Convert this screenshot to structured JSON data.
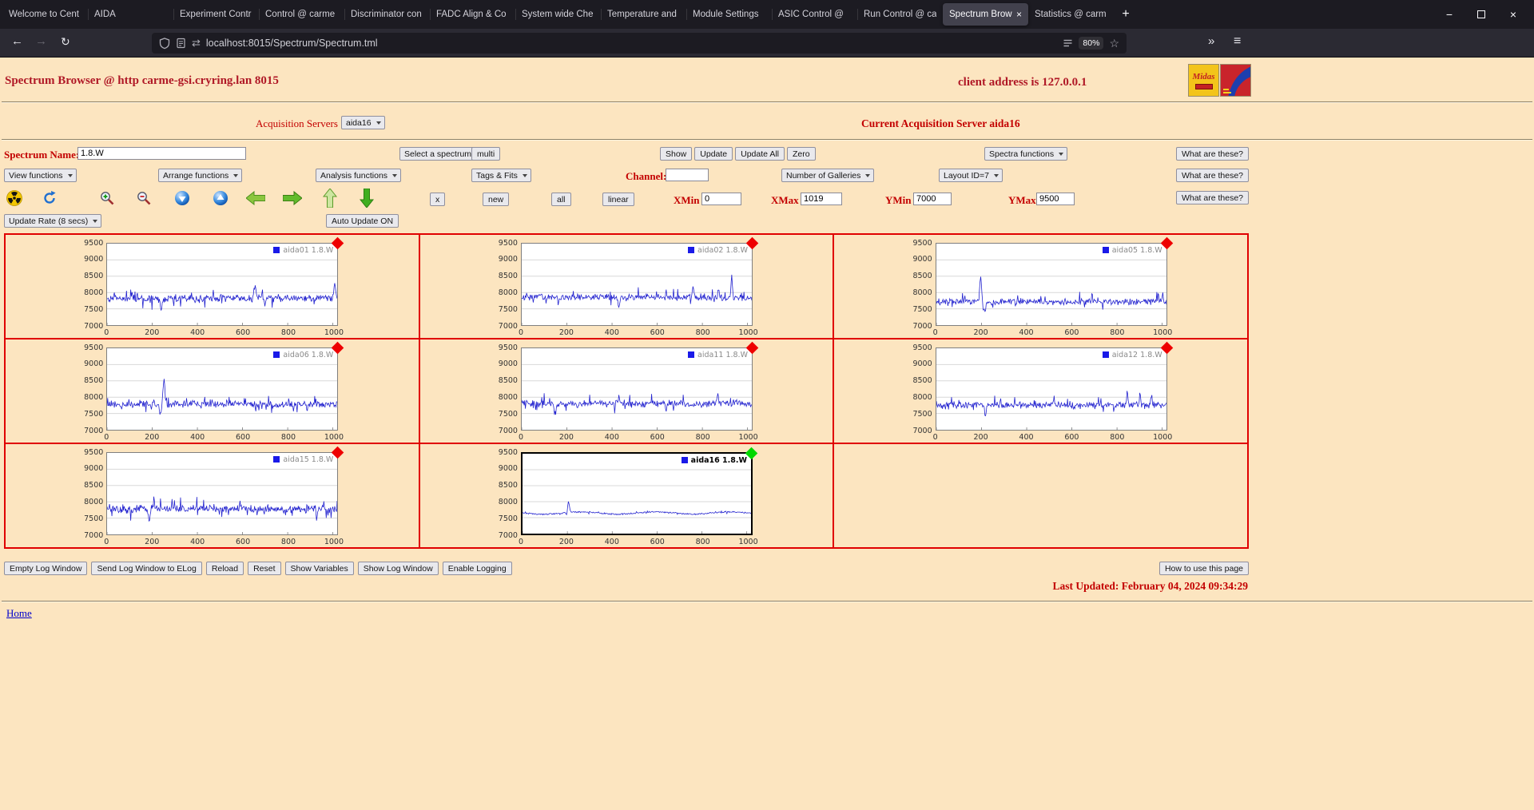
{
  "colors": {
    "page_bg": "#fce5c0",
    "header_red": "#b01826",
    "label_red": "#c30000",
    "grid_red": "#e00000",
    "link_blue": "#0000cc"
  },
  "icons": {
    "back": "←",
    "forward": "→",
    "reload": "↻",
    "overflow": "»",
    "menu": "≡",
    "star": "☆",
    "tune": "⇄",
    "minimize": "−",
    "close": "×",
    "new_tab": "+",
    "tab_close": "×"
  },
  "browser": {
    "tabs": [
      "Welcome to Cent",
      "AIDA",
      "Experiment Contr",
      "Control @ carme",
      "Discriminator con",
      "FADC Align & Co",
      "System wide Che",
      "Temperature and",
      "Module Settings",
      "ASIC Control @",
      "Run Control @ ca",
      "Spectrum Brow",
      "Statistics @ carm"
    ],
    "active_tab_index": 11,
    "url": "localhost:8015/Spectrum/Spectrum.tml",
    "zoom_badge": "80%"
  },
  "page": {
    "header": {
      "title": "Spectrum Browser @ http carme-gsi.cryring.lan 8015",
      "client": "client address is 127.0.0.1",
      "midas_logo_text": "Midas"
    },
    "acquisition": {
      "label": "Acquisition Servers",
      "server": "aida16",
      "current": "Current Acquisition Server aida16"
    },
    "controls": {
      "spectrum_name_label": "Spectrum Name:",
      "spectrum_name_value": "1.8.W",
      "select_spectrum": "Select a spectrum",
      "multi": "multi",
      "show": "Show",
      "update": "Update",
      "update_all": "Update All",
      "zero": "Zero",
      "spectra_functions": "Spectra functions",
      "what_are_these": "What are these?",
      "view_functions": "View functions",
      "arrange_functions": "Arrange functions",
      "analysis_functions": "Analysis functions",
      "tags_fits": "Tags & Fits",
      "channel_label": "Channel:",
      "channel_value": "",
      "number_of_galleries": "Number of Galleries",
      "layout_id": "Layout ID=7",
      "x_button": "x",
      "new_button": "new",
      "all_button": "all",
      "linear_button": "linear",
      "xmin_label": "XMin",
      "xmin": "0",
      "xmax_label": "XMax",
      "xmax": "1019",
      "ymin_label": "YMin",
      "ymin": "7000",
      "ymax_label": "YMax",
      "ymax": "9500",
      "update_rate": "Update Rate (8 secs)",
      "auto_update": "Auto Update ON"
    },
    "footer": {
      "buttons": [
        "Empty Log Window",
        "Send Log Window to ELog",
        "Reload",
        "Reset",
        "Show Variables",
        "Show Log Window",
        "Enable Logging"
      ],
      "help": "How to use this page",
      "last_updated": "Last Updated: February 04, 2024 09:34:29",
      "home": "Home"
    }
  },
  "chart_data": {
    "type": "line",
    "x_range": [
      0,
      1019
    ],
    "y_range": [
      7000,
      9500
    ],
    "x_ticks": [
      0,
      200,
      400,
      600,
      800,
      1000
    ],
    "y_ticks": [
      7000,
      7500,
      8000,
      8500,
      9000,
      9500
    ],
    "line_color": "#2323cf",
    "legend_color": "#1a1ae8",
    "panels": [
      {
        "legend": "aida01 1.8.W",
        "marker": "#ee0000",
        "baseline": 7820,
        "noise": 135,
        "wave": [
          15,
          215
        ],
        "spikes": [
          [
            240,
            -330,
            4
          ],
          [
            655,
            410,
            5
          ],
          [
            700,
            -290,
            4
          ],
          [
            1008,
            450,
            4
          ]
        ],
        "seed": 11
      },
      {
        "legend": "aida02 1.8.W",
        "marker": "#ee0000",
        "baseline": 7855,
        "noise": 120,
        "wave": [
          15,
          260
        ],
        "spikes": [
          [
            430,
            -270,
            4
          ],
          [
            760,
            330,
            4
          ],
          [
            872,
            300,
            3
          ],
          [
            930,
            780,
            3
          ]
        ],
        "seed": 7
      },
      {
        "legend": "aida05 1.8.W",
        "marker": "#ee0000",
        "baseline": 7715,
        "noise": 110,
        "wave": [
          14,
          300
        ],
        "spikes": [
          [
            196,
            860,
            4
          ],
          [
            214,
            -330,
            4
          ],
          [
            690,
            240,
            3
          ],
          [
            1002,
            260,
            3
          ]
        ],
        "seed": 19
      },
      {
        "legend": "aida06 1.8.W",
        "marker": "#ee0000",
        "baseline": 7785,
        "noise": 115,
        "wave": [
          12,
          240
        ],
        "spikes": [
          [
            236,
            -410,
            4
          ],
          [
            252,
            840,
            4
          ],
          [
            610,
            260,
            3
          ],
          [
            885,
            -260,
            3
          ]
        ],
        "seed": 23
      },
      {
        "legend": "aida11 1.8.W",
        "marker": "#ee0000",
        "baseline": 7795,
        "noise": 125,
        "wave": [
          13,
          275
        ],
        "spikes": [
          [
            150,
            -270,
            4
          ],
          [
            432,
            270,
            3
          ],
          [
            640,
            -260,
            3
          ],
          [
            868,
            330,
            3
          ]
        ],
        "seed": 31
      },
      {
        "legend": "aida12 1.8.W",
        "marker": "#ee0000",
        "baseline": 7755,
        "noise": 120,
        "wave": [
          13,
          235
        ],
        "spikes": [
          [
            218,
            -280,
            4
          ],
          [
            520,
            250,
            3
          ],
          [
            845,
            500,
            3
          ],
          [
            902,
            440,
            3
          ],
          [
            952,
            390,
            3
          ]
        ],
        "seed": 37
      },
      {
        "legend": "aida15 1.8.W",
        "marker": "#ee0000",
        "baseline": 7785,
        "noise": 140,
        "wave": [
          15,
          250
        ],
        "spikes": [
          [
            186,
            -440,
            4
          ],
          [
            208,
            350,
            3
          ],
          [
            590,
            280,
            3
          ],
          [
            928,
            -290,
            3
          ]
        ],
        "seed": 41
      },
      {
        "legend": "aida16 1.8.W",
        "marker": "#00d800",
        "selected": true,
        "baseline": 7645,
        "noise": 26,
        "wave": [
          36,
          335
        ],
        "spikes": [
          [
            197,
            -130,
            3
          ],
          [
            205,
            410,
            4
          ]
        ],
        "seed": 47
      }
    ]
  }
}
